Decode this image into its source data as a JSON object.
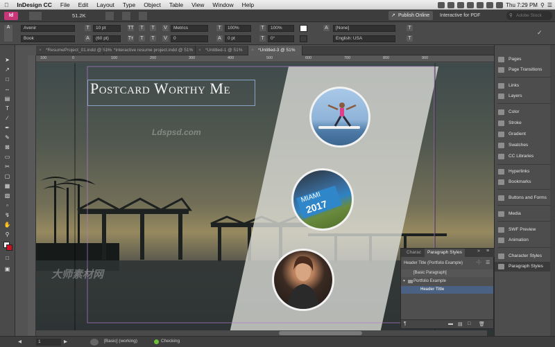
{
  "menubar": {
    "app_name": "InDesign CC",
    "items": [
      "File",
      "Edit",
      "Layout",
      "Type",
      "Object",
      "Table",
      "View",
      "Window",
      "Help"
    ],
    "clock": "Thu 7:29 PM"
  },
  "appbar": {
    "zoom": "51.2K",
    "publish_label": "Publish Online",
    "workspace": "Interactive for PDF",
    "search_placeholder": "Adobe Stock"
  },
  "control": {
    "font_family": "Avenir",
    "font_style": "Book",
    "font_size": "10 pt",
    "leading": "(60 pt)",
    "kerning": "Metrics",
    "tracking": "0",
    "vscale": "100%",
    "hscale": "100%",
    "baseline": "0 pt",
    "skew": "0°",
    "char_style": "[None]",
    "language": "English: USA"
  },
  "tabs": [
    {
      "label": "*ResumeProject_01.indd @ 51%",
      "active": false
    },
    {
      "label": "*interactive resume project.indd @ 51%",
      "active": false
    },
    {
      "label": "*Untitled-1 @ 51%",
      "active": false
    },
    {
      "label": "*Untitled-3 @ 51%",
      "active": true
    }
  ],
  "ruler_ticks": [
    "100",
    "0",
    "100",
    "200",
    "300",
    "400",
    "500",
    "600",
    "700",
    "800",
    "900"
  ],
  "document": {
    "title_text": "Postcard Worthy Me",
    "watermark_top": "Ldspsd.com",
    "watermark_cn": "大师素材网"
  },
  "panels": [
    {
      "label": "Pages",
      "icon": "pages-icon",
      "group": 1
    },
    {
      "label": "Page Transitions",
      "icon": "page-transitions-icon",
      "group": 1
    },
    {
      "label": "Links",
      "icon": "links-icon",
      "group": 2
    },
    {
      "label": "Layers",
      "icon": "layers-icon",
      "group": 2
    },
    {
      "label": "Color",
      "icon": "color-icon",
      "group": 3
    },
    {
      "label": "Stroke",
      "icon": "stroke-icon",
      "group": 3
    },
    {
      "label": "Gradient",
      "icon": "gradient-icon",
      "group": 3
    },
    {
      "label": "Swatches",
      "icon": "swatches-icon",
      "group": 3
    },
    {
      "label": "CC Libraries",
      "icon": "cc-libraries-icon",
      "group": 3
    },
    {
      "label": "Hyperlinks",
      "icon": "hyperlinks-icon",
      "group": 4
    },
    {
      "label": "Bookmarks",
      "icon": "bookmarks-icon",
      "group": 4
    },
    {
      "label": "Buttons and Forms",
      "icon": "buttons-forms-icon",
      "group": 5
    },
    {
      "label": "Media",
      "icon": "media-icon",
      "group": 6
    },
    {
      "label": "SWF Preview",
      "icon": "swf-preview-icon",
      "group": 7
    },
    {
      "label": "Animation",
      "icon": "animation-icon",
      "group": 7
    },
    {
      "label": "Character Styles",
      "icon": "character-styles-icon",
      "group": 8
    },
    {
      "label": "Paragraph Styles",
      "icon": "paragraph-styles-icon",
      "group": 8,
      "selected": true
    }
  ],
  "para_panel": {
    "tab_char": "Charac",
    "tab_para": "Paragraph Styles",
    "current": "Header Title (Portfolio Example)",
    "rows": [
      {
        "label": "[Basic Paragraph]",
        "indent": 1,
        "selected": false
      },
      {
        "label": "Portfolio Example",
        "indent": 0,
        "selected": false,
        "folder": true
      },
      {
        "label": "Header Title",
        "indent": 2,
        "selected": true
      }
    ]
  },
  "status": {
    "page": "1",
    "style": "[Basic] (working)",
    "preflight": "Checking"
  },
  "colors": {
    "accent_blue": "#8aa4c8",
    "selected_row": "#4a6184",
    "watermark": "#e6e6e6"
  }
}
